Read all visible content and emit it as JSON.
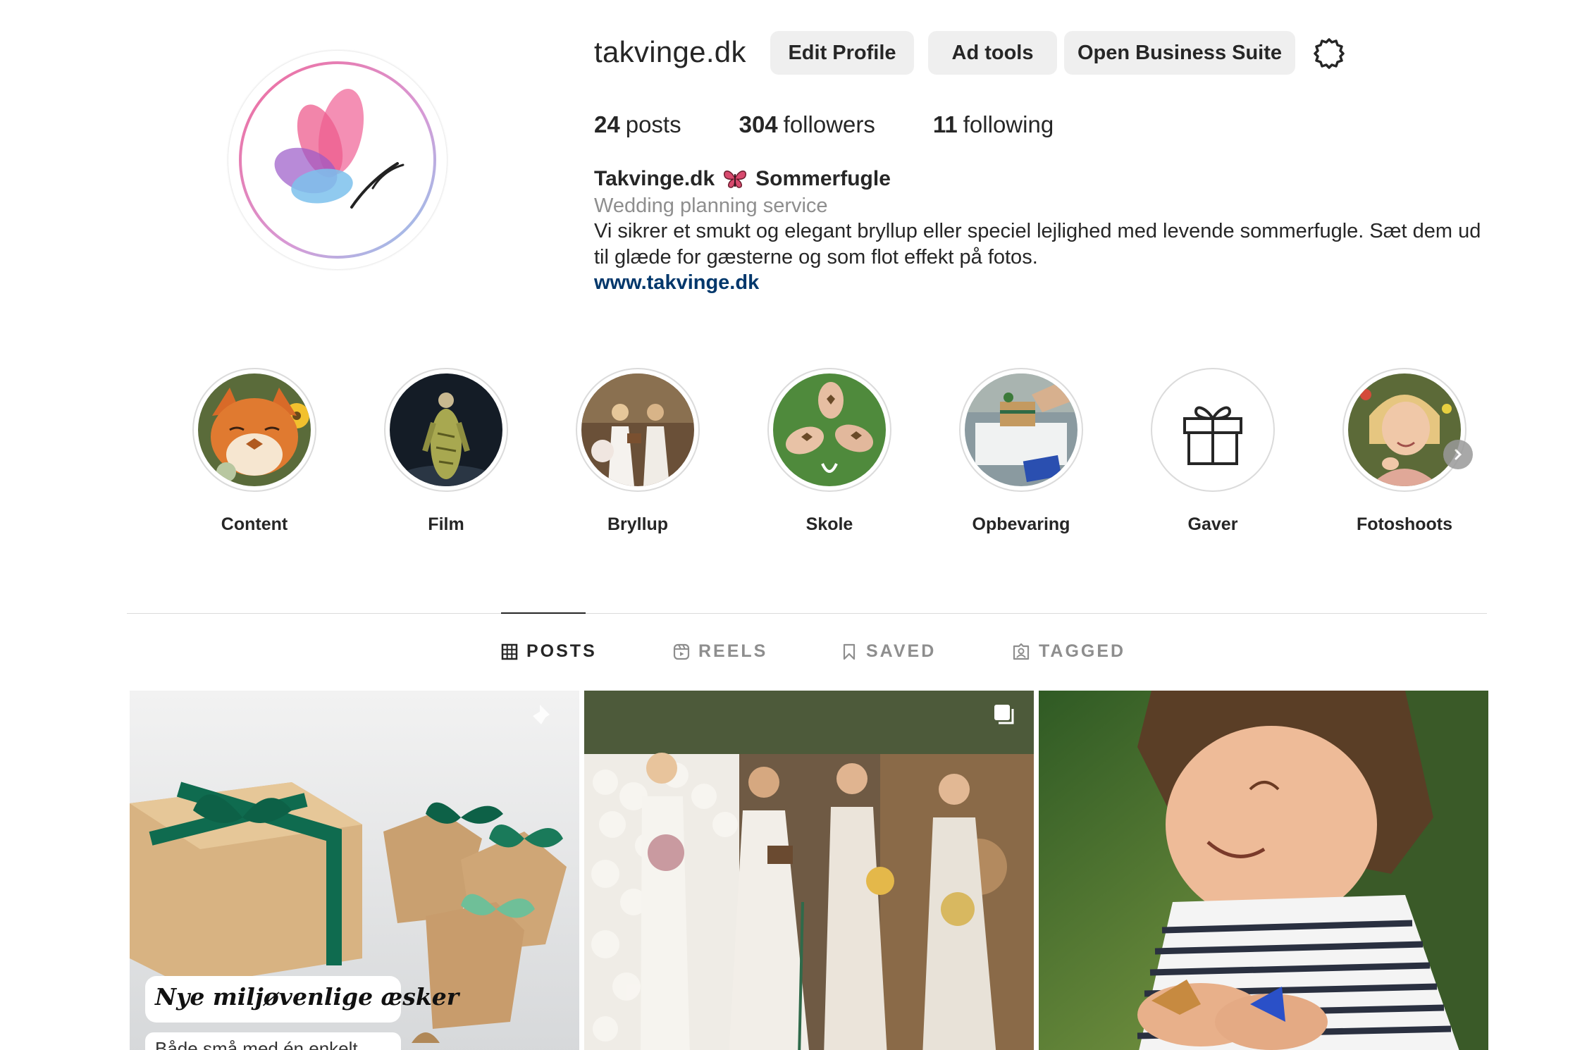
{
  "profile": {
    "username": "takvinge.dk",
    "buttons": {
      "edit": "Edit Profile",
      "ad_tools": "Ad tools",
      "business": "Open Business Suite"
    },
    "stats": {
      "posts_count": "24",
      "posts_label": "posts",
      "followers_count": "304",
      "followers_label": "followers",
      "following_count": "11",
      "following_label": "following"
    },
    "bio": {
      "name_part1": "Takvinge.dk",
      "name_part2": "Sommerfugle",
      "category": "Wedding planning service",
      "text": "Vi sikrer et smukt og elegant bryllup eller speciel lejlighed med levende sommerfugle. Sæt dem ud til glæde for gæsterne og som flot effekt på fotos.",
      "link": "www.takvinge.dk"
    }
  },
  "highlights": [
    {
      "label": "Content"
    },
    {
      "label": "Film"
    },
    {
      "label": "Bryllup"
    },
    {
      "label": "Skole"
    },
    {
      "label": "Opbevaring"
    },
    {
      "label": "Gaver"
    },
    {
      "label": "Fotoshoots"
    }
  ],
  "tabs": [
    {
      "label": "POSTS",
      "active": true
    },
    {
      "label": "REELS",
      "active": false
    },
    {
      "label": "SAVED",
      "active": false
    },
    {
      "label": "TAGGED",
      "active": false
    }
  ],
  "posts": [
    {
      "caption_title": "Nye miljøvenlige æsker",
      "caption_sub": "Både små med én enkelt"
    },
    {
      "caption_title": "",
      "caption_sub": ""
    },
    {
      "caption_title": "",
      "caption_sub": ""
    }
  ],
  "colors": {
    "link": "#00376b",
    "button_bg": "#efefef",
    "muted": "#8e8e8e",
    "ribbon_green": "#0f6b4f"
  },
  "icons": [
    "gear-icon",
    "butterfly-icon",
    "gift-icon",
    "chevron-right-icon",
    "grid-icon",
    "reels-icon",
    "bookmark-icon",
    "tag-person-icon",
    "pin-icon",
    "carousel-icon"
  ]
}
